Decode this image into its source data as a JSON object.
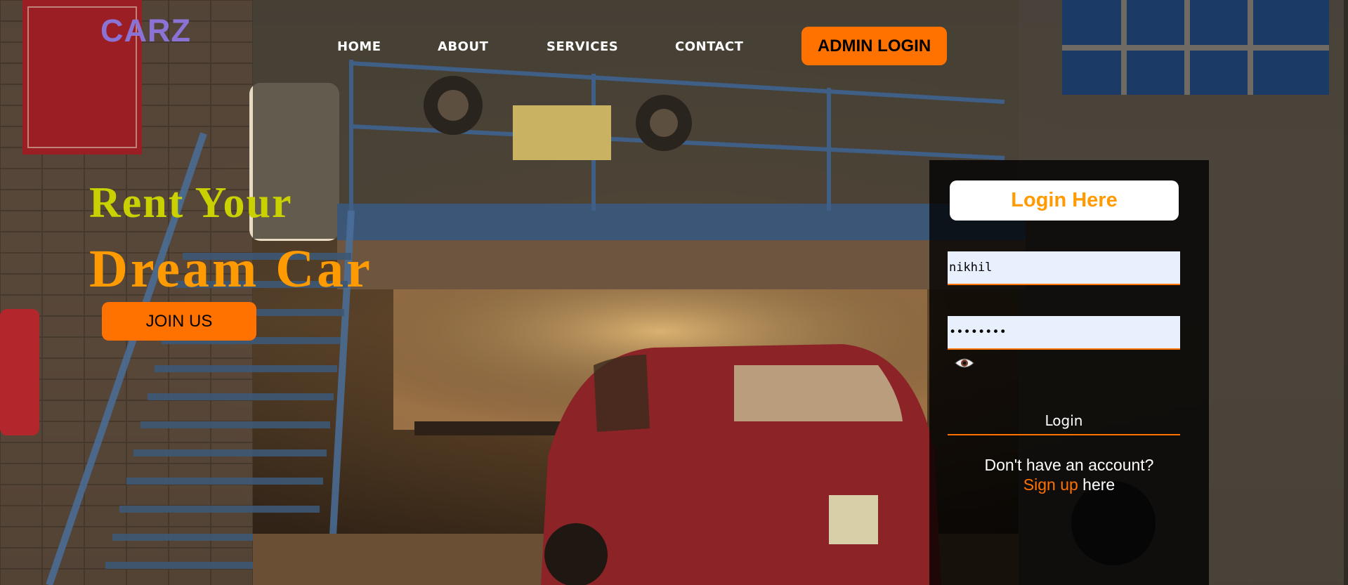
{
  "brand": {
    "logo": "CARZ"
  },
  "nav": {
    "items": [
      {
        "label": "HOME"
      },
      {
        "label": "ABOUT"
      },
      {
        "label": "SERVICES"
      },
      {
        "label": "CONTACT"
      }
    ],
    "admin_label": "ADMIN LOGIN"
  },
  "hero": {
    "line1": "Rent Your",
    "line2": "Dream Car",
    "join_label": "JOIN US"
  },
  "login": {
    "title": "Login Here",
    "username_value": "nikhil",
    "password_value": "••••••••",
    "button_label": "Login",
    "no_account": "Don't have an account?",
    "signup_link": "Sign up",
    "signup_suffix": "here"
  },
  "colors": {
    "accent": "#ff7200",
    "logo": "#8b73d6",
    "hero_line1": "#c9d200",
    "hero_line2": "#ff9a00",
    "input_bg": "#e8f0fe"
  },
  "icons": {
    "password_toggle": "eye-icon"
  }
}
